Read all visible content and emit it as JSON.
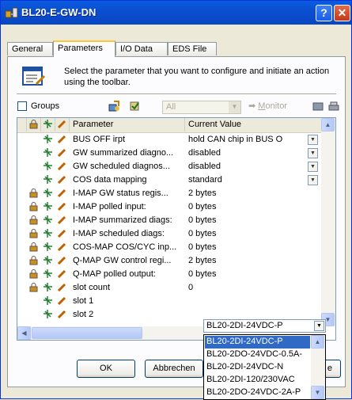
{
  "window": {
    "title": "BL20-E-GW-DN"
  },
  "tabs": [
    {
      "label": "General"
    },
    {
      "label": "Parameters"
    },
    {
      "label": "I/O Data"
    },
    {
      "label": "EDS File"
    }
  ],
  "instruction": "Select the parameter that you want to configure and initiate an action using the toolbar.",
  "toolbar": {
    "groups_label": "Groups",
    "filter_value": "All",
    "monitor_label": "Monitor",
    "monitor_underline": "M",
    "monitor_rest": "onitor"
  },
  "grid": {
    "columns": {
      "parameter": "Parameter",
      "value": "Current Value"
    },
    "rows": [
      {
        "name": "BUS OFF irpt",
        "value": "hold CAN chip in BUS O",
        "lock": false,
        "combo": true
      },
      {
        "name": "GW summarized diagno...",
        "value": "disabled",
        "lock": false,
        "combo": true
      },
      {
        "name": "GW scheduled diagnos...",
        "value": "disabled",
        "lock": false,
        "combo": true
      },
      {
        "name": "COS data mapping",
        "value": "standard",
        "lock": false,
        "combo": true
      },
      {
        "name": "I-MAP GW status regis...",
        "value": "2 bytes",
        "lock": true,
        "combo": false
      },
      {
        "name": "I-MAP polled input:",
        "value": "0 bytes",
        "lock": true,
        "combo": false
      },
      {
        "name": "I-MAP summarized diags:",
        "value": "0 bytes",
        "lock": true,
        "combo": false
      },
      {
        "name": "I-MAP scheduled diags:",
        "value": "0 bytes",
        "lock": true,
        "combo": false
      },
      {
        "name": "COS-MAP COS/CYC inp...",
        "value": "0 bytes",
        "lock": true,
        "combo": false
      },
      {
        "name": "Q-MAP GW control regi...",
        "value": "2 bytes",
        "lock": true,
        "combo": false
      },
      {
        "name": "Q-MAP polled output:",
        "value": "0 bytes",
        "lock": true,
        "combo": false
      },
      {
        "name": "slot count",
        "value": "0",
        "lock": true,
        "combo": false
      },
      {
        "name": "slot 1",
        "value": "",
        "lock": false,
        "combo": false
      },
      {
        "name": "slot 2",
        "value": "",
        "lock": false,
        "combo": false
      }
    ]
  },
  "dropdown": {
    "current": "BL20-2DI-24VDC-P",
    "options": [
      "BL20-2DI-24VDC-P",
      "BL20-2DO-24VDC-0.5A-",
      "BL20-2DI-24VDC-N",
      "BL20-2DI-120/230VAC",
      "BL20-2DO-24VDC-2A-P"
    ],
    "selected_index": 0
  },
  "buttons": {
    "ok": "OK",
    "cancel": "Abbrechen",
    "partial_right": "e"
  },
  "colors": {
    "title_bar": "#0b4fd0",
    "selection": "#316ac5",
    "tab_highlight": "#ffc83c"
  }
}
